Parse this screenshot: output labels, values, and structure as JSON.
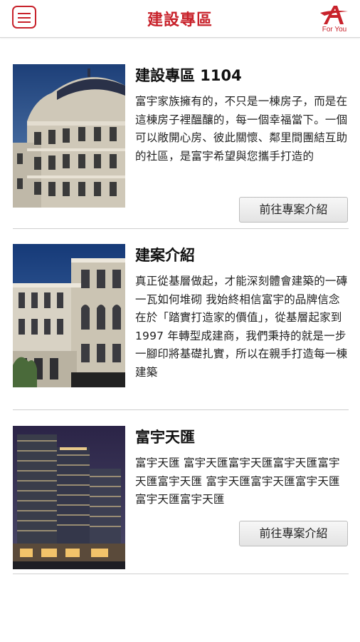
{
  "header": {
    "title": "建設專區",
    "logo_text": "For You"
  },
  "accent_color": "#c8222b",
  "cards": [
    {
      "title": "建設專區 1104",
      "description": "富宇家族擁有的，不只是一棟房子，而是在這棟房子裡醞釀的，每一個幸福當下。一個可以敞開心房、彼此關懷、鄰里間團結互助的社區，是富宇希望與您攜手打造的",
      "button_label": "前往專案介紹"
    },
    {
      "title": "建案介紹",
      "description": "真正從基層做起，才能深刻體會建築的一磚一瓦如何堆砌 我始終相信富宇的品牌信念在於「踏實打造家的價值」，從基層起家到 1997 年轉型成建商，我們秉持的就是一步一腳印將基礎扎實，所以在親手打造每一棟建築"
    },
    {
      "title": "富宇天匯",
      "description": "富宇天匯 富宇天匯富宇天匯富宇天匯富宇天匯富宇天匯 富宇天匯富宇天匯富宇天匯富宇天匯富宇天匯",
      "button_label": "前往專案介紹"
    }
  ]
}
